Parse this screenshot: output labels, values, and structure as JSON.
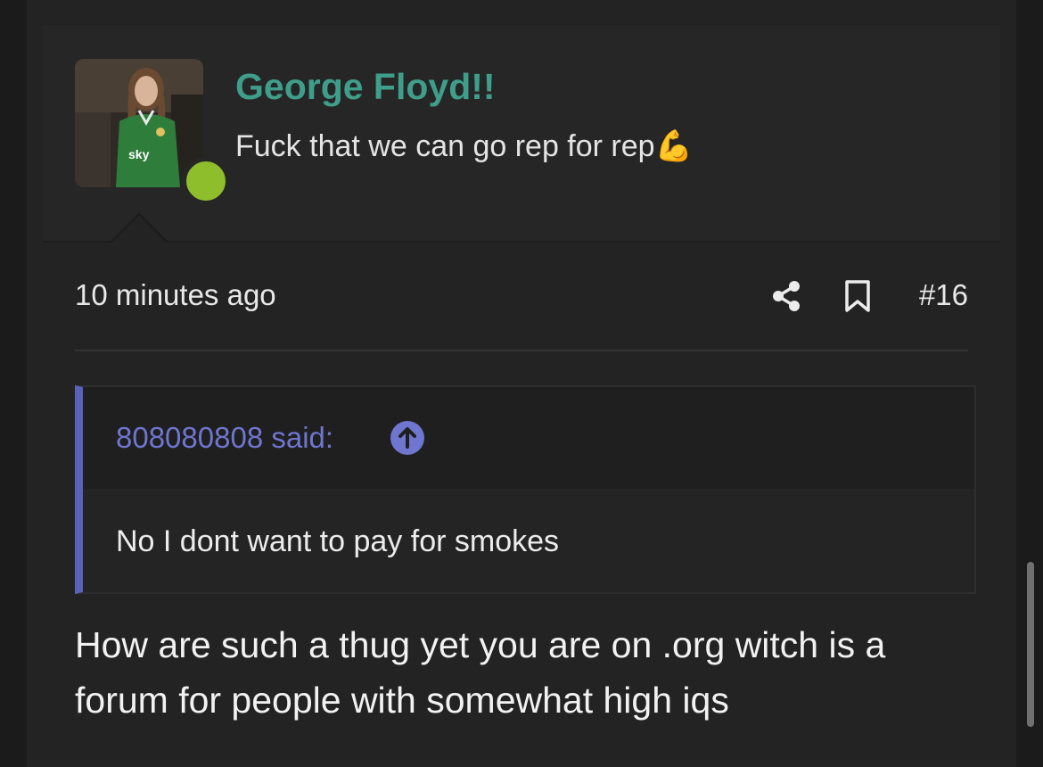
{
  "author": {
    "username": "George Floyd!!",
    "title": "Fuck that we can go rep for rep💪",
    "online": true
  },
  "post": {
    "timestamp": "10 minutes ago",
    "number": "#16",
    "message": "How are such a thug yet you are on .org witch is a forum for people with somewhat high iqs"
  },
  "quote": {
    "author_label": "808080808 said:",
    "body": "No I dont want to pay for smokes"
  },
  "icons": {
    "share": "share-icon",
    "bookmark": "bookmark-icon",
    "quote_jump": "arrow-up-circle-icon"
  },
  "colors": {
    "username": "#3f9e8a",
    "quote_accent": "#5a62b8",
    "quote_author": "#6f76cf",
    "online": "#8fbe2c"
  }
}
